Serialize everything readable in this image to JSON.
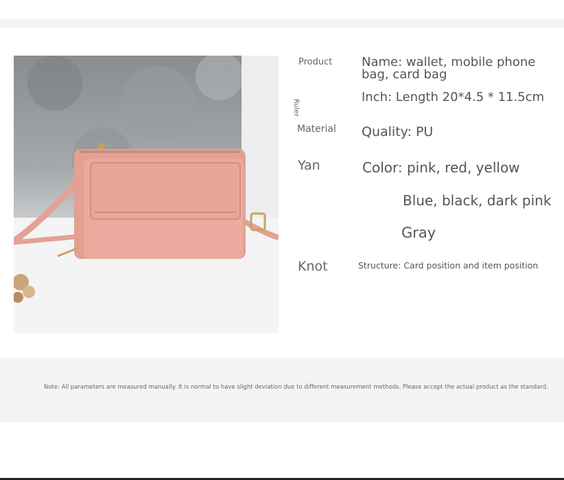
{
  "specs": {
    "product": {
      "label": "Product",
      "value": "Name: wallet, mobile phone bag, card bag"
    },
    "ruler": {
      "label": "Ruler",
      "value": "Inch: Length 20*4.5 * 11.5cm"
    },
    "material": {
      "label": "Material",
      "value": "Quality: PU"
    },
    "color": {
      "label": "Yan",
      "value": "Color: pink, red, yellow",
      "line2": "Blue, black, dark pink",
      "line3": "Gray"
    },
    "structure": {
      "label": "Knot",
      "value": "Structure: Card position and item position"
    }
  },
  "note": "Note: All parameters are measured manually. It is normal to have slight deviation due to different measurement methods. Please accept the actual product as the standard.",
  "colors": {
    "bag": "#e8a598",
    "bag_dark": "#d88f83",
    "background": "#f4f4f4"
  }
}
